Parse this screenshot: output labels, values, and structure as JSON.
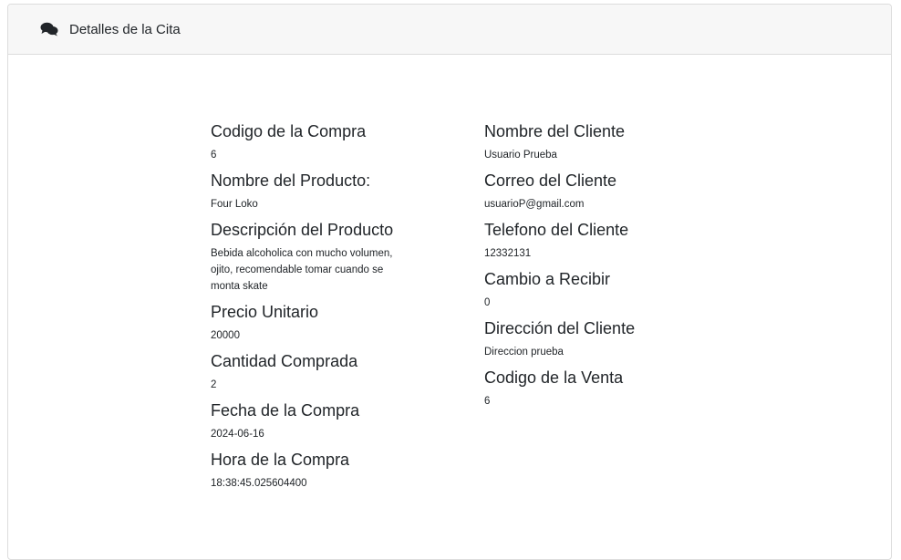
{
  "header": {
    "title": "Detalles de la Cita",
    "icon": "comments-icon"
  },
  "left": [
    {
      "label": "Codigo de la Compra",
      "value": "6"
    },
    {
      "label": "Nombre del Producto:",
      "value": "Four Loko"
    },
    {
      "label": "Descripción del Producto",
      "value": "Bebida alcoholica con mucho volumen, ojito, recomendable tomar cuando se monta skate"
    },
    {
      "label": "Precio Unitario",
      "value": "20000"
    },
    {
      "label": "Cantidad Comprada",
      "value": "2"
    },
    {
      "label": "Fecha de la Compra",
      "value": "2024-06-16"
    },
    {
      "label": "Hora de la Compra",
      "value": "18:38:45.025604400"
    }
  ],
  "right": [
    {
      "label": "Nombre del Cliente",
      "value": "Usuario Prueba"
    },
    {
      "label": "Correo del Cliente",
      "value": "usuarioP@gmail.com"
    },
    {
      "label": "Telefono del Cliente",
      "value": "12332131"
    },
    {
      "label": "Cambio a Recibir",
      "value": "0"
    },
    {
      "label": "Dirección del Cliente",
      "value": "Direccion prueba"
    },
    {
      "label": "Codigo de la Venta",
      "value": "6"
    }
  ]
}
